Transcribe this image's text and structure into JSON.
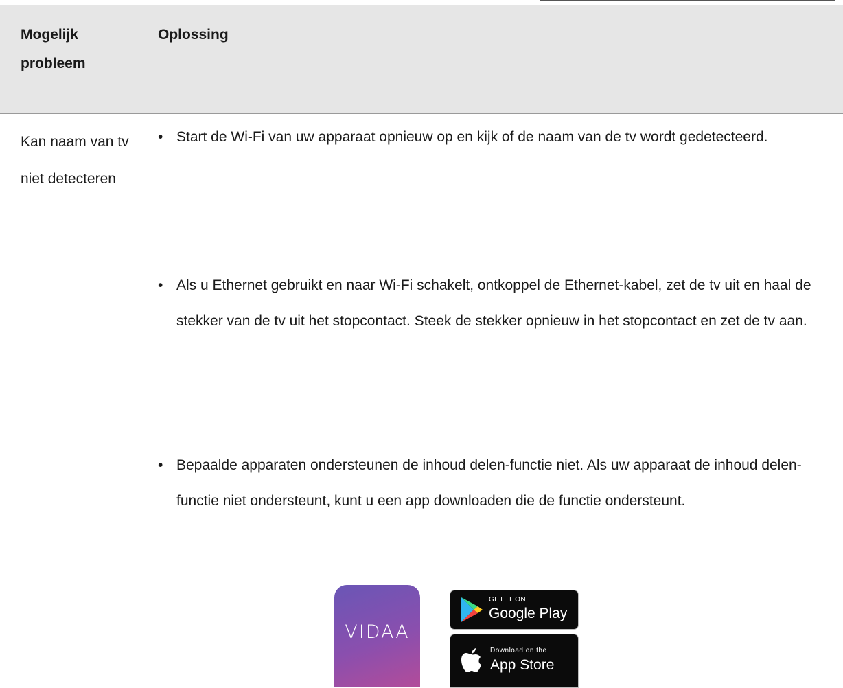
{
  "table": {
    "headers": {
      "problem": "Mogelijk probleem",
      "solution": "Oplossing"
    },
    "rows": [
      {
        "problem": "Kan naam van tv niet detecteren",
        "solutions": [
          "Start de Wi-Fi van uw apparaat opnieuw op en kijk of de naam van de tv wordt gedetecteerd.",
          "Als u Ethernet gebruikt en naar Wi-Fi schakelt, ontkoppel de Ethernet-kabel, zet de tv uit en haal de stekker van de tv uit het stopcontact. Steek de stekker opnieuw in het stopcontact en zet de tv aan.",
          "Bepaalde apparaten ondersteunen de inhoud delen-functie niet. Als uw apparaat de inhoud delen-functie niet ondersteunt, kunt u een app downloaden die de functie ondersteunt."
        ]
      }
    ]
  },
  "bullet_char": "•",
  "apps": {
    "vidaa": {
      "label": "VIDAA",
      "icon": "vidaa-app-icon"
    },
    "google_play": {
      "small": "GET IT ON",
      "big": "Google Play",
      "icon": "google-play-icon"
    },
    "app_store": {
      "small": "Download on the",
      "big": "App Store",
      "icon": "apple-icon"
    }
  }
}
